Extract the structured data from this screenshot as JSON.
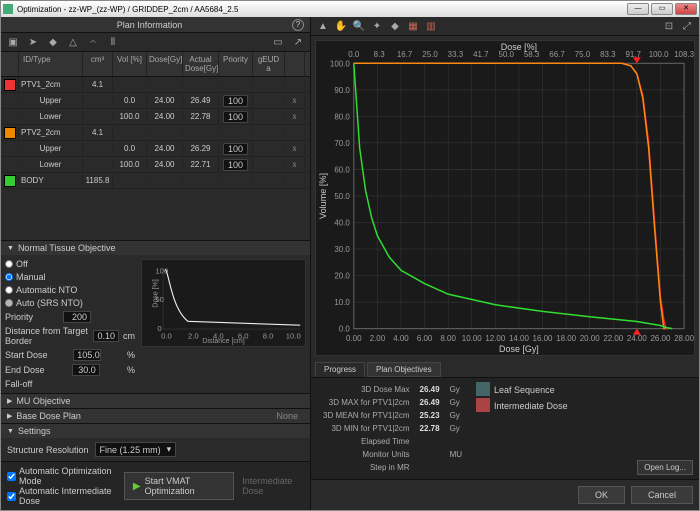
{
  "window": {
    "title": "Optimization - zz-WP_(zz-WP) / GRIDDEP_2cm / AA5684_2.5"
  },
  "plan_header": "Plan Information",
  "columns": {
    "idtype": "ID/Type",
    "cm3": "cm³",
    "volpct": "Vol [%]",
    "dosegy": "Dose[Gy]",
    "actdose": "Actual Dose[Gy]",
    "priority": "Priority",
    "geud": "gEUD a"
  },
  "structures": [
    {
      "color": "red",
      "name": "PTV1_2cm",
      "cm3": "4.1",
      "rows": [
        {
          "type": "Upper",
          "vol": "0.0",
          "dose": "24.00",
          "act": "26.49",
          "pri": "100",
          "x": "x"
        },
        {
          "type": "Lower",
          "vol": "100.0",
          "dose": "24.00",
          "act": "22.78",
          "pri": "100",
          "x": "x"
        }
      ]
    },
    {
      "color": "org",
      "name": "PTV2_2cm",
      "cm3": "4.1",
      "rows": [
        {
          "type": "Upper",
          "vol": "0.0",
          "dose": "24.00",
          "act": "26.29",
          "pri": "100",
          "x": "x"
        },
        {
          "type": "Lower",
          "vol": "100.0",
          "dose": "24.00",
          "act": "22.71",
          "pri": "100",
          "x": "x"
        }
      ]
    },
    {
      "color": "grn",
      "name": "BODY",
      "cm3": "1185.8",
      "rows": []
    }
  ],
  "nto": {
    "title": "Normal Tissue Objective",
    "opt_off": "Off",
    "opt_manual": "Manual",
    "opt_auto": "Automatic NTO",
    "opt_srs": "Auto (SRS NTO)",
    "priority_lbl": "Priority",
    "priority": "200",
    "dist_lbl": "Distance from Target Border",
    "dist": "0.10",
    "dist_u": "cm",
    "start_lbl": "Start Dose",
    "start": "105.0",
    "start_u": "%",
    "end_lbl": "End Dose",
    "end": "30.0",
    "end_u": "%",
    "falloff_lbl": "Fall-off",
    "y": "Dose [%]",
    "x": "Distance [cm]",
    "yticks": [
      "0",
      "50",
      "100"
    ],
    "xticks": [
      "0.0",
      "2.0",
      "4.0",
      "6.0",
      "8.0",
      "10.0"
    ]
  },
  "mu": {
    "title": "MU Objective"
  },
  "base": {
    "title": "Base Dose Plan",
    "value": "None"
  },
  "settings": {
    "title": "Settings",
    "res_lbl": "Structure Resolution",
    "res_val": "Fine (1.25 mm)"
  },
  "footer": {
    "auto_mode": "Automatic Optimization Mode",
    "auto_inter": "Automatic Intermediate Dose",
    "start": "Start VMAT Optimization",
    "inter": "Intermediate Dose"
  },
  "chart_data": {
    "type": "line",
    "title": "",
    "xlabel": "Dose [Gy]",
    "ylabel": "Volume [%]",
    "x2label": "Dose [%]",
    "xlim": [
      0,
      28
    ],
    "ylim": [
      0,
      100
    ],
    "xticks": [
      "0.00",
      "2.00",
      "4.00",
      "6.00",
      "8.00",
      "10.00",
      "12.00",
      "14.00",
      "16.00",
      "18.00",
      "20.00",
      "22.00",
      "24.00",
      "26.00",
      "28.00"
    ],
    "yticks": [
      "0.0",
      "10.0",
      "20.0",
      "30.0",
      "40.0",
      "50.0",
      "60.0",
      "70.0",
      "80.0",
      "90.0",
      "100.0"
    ],
    "x2ticks": [
      "0.0",
      "8.3",
      "16.7",
      "25.0",
      "33.3",
      "41.7",
      "50.0",
      "58.3",
      "66.7",
      "75.0",
      "83.3",
      "91.7",
      "100.0",
      "108.3"
    ],
    "series": [
      {
        "name": "PTV1_2cm",
        "color": "#ff2020",
        "x": [
          0,
          22.78,
          23.5,
          24,
          24.5,
          25,
          25.5,
          26,
          26.3,
          26.49,
          26.6
        ],
        "values": [
          100,
          100,
          99,
          96,
          88,
          70,
          40,
          12,
          3,
          0,
          0
        ]
      },
      {
        "name": "PTV2_2cm",
        "color": "#ff8810",
        "x": [
          0,
          22.71,
          23.5,
          24,
          24.5,
          25,
          25.5,
          26,
          26.29,
          26.4
        ],
        "values": [
          100,
          100,
          99,
          96,
          87,
          68,
          38,
          10,
          0,
          0
        ]
      },
      {
        "name": "BODY",
        "color": "#30dd30",
        "x": [
          0,
          0.5,
          1,
          1.5,
          2,
          3,
          4,
          6,
          8,
          12,
          16,
          20,
          22,
          24,
          26,
          26.5,
          27
        ],
        "values": [
          100,
          68,
          52,
          42,
          35,
          27,
          22,
          17,
          13,
          9,
          6.5,
          4.5,
          3.6,
          2.7,
          1.2,
          0.4,
          0
        ]
      }
    ],
    "markers": [
      {
        "x": 24,
        "y": 0,
        "shape": "up",
        "color": "#ff2020"
      },
      {
        "x": 24,
        "y": 100,
        "shape": "down",
        "color": "#ff2020"
      }
    ]
  },
  "tabs": {
    "progress": "Progress",
    "objectives": "Plan Objectives"
  },
  "stats": [
    {
      "k": "3D Dose Max",
      "v": "26.49",
      "u": "Gy"
    },
    {
      "k": "3D MAX for PTV1|2cm",
      "v": "26.49",
      "u": "Gy"
    },
    {
      "k": "3D MEAN for PTV1|2cm",
      "v": "25.23",
      "u": "Gy"
    },
    {
      "k": "3D MIN for PTV1|2cm",
      "v": "22.78",
      "u": "Gy"
    },
    {
      "k": "Elapsed Time",
      "v": "",
      "u": ""
    },
    {
      "k": "Monitor Units",
      "v": "",
      "u": "MU"
    },
    {
      "k": "Step in MR",
      "v": "",
      "u": ""
    }
  ],
  "side": {
    "leaf": "Leaf Sequence",
    "inter": "Intermediate Dose"
  },
  "openlog": "Open Log...",
  "ok": "OK",
  "cancel": "Cancel"
}
